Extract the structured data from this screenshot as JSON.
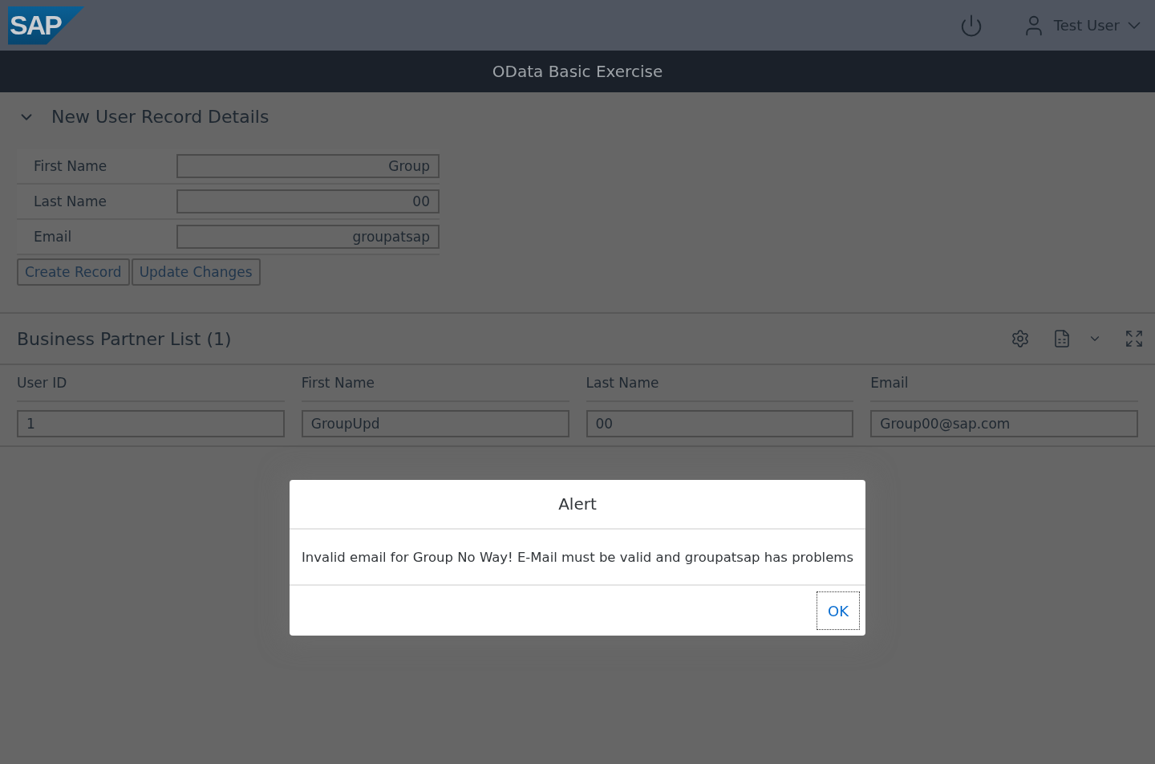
{
  "shell": {
    "logo": "SAP",
    "user": "Test User"
  },
  "app_title": "OData Basic Exercise",
  "form": {
    "title": "New User Record Details",
    "expanded": true,
    "fields": [
      {
        "label": "First Name",
        "value": "Group"
      },
      {
        "label": "Last Name",
        "value": "00"
      },
      {
        "label": "Email",
        "value": "groupatsap"
      }
    ],
    "buttons": [
      "Create Record",
      "Update Changes"
    ]
  },
  "table": {
    "title": "Business Partner List (1)",
    "columns": [
      "User ID",
      "First Name",
      "Last Name",
      "Email"
    ],
    "rows": [
      [
        "1",
        "GroupUpd",
        "00",
        "Group00@sap.com"
      ]
    ]
  },
  "dialog": {
    "title": "Alert",
    "message": "Invalid email for Group No Way! E-Mail must be valid and groupatsap has problems",
    "buttons": [
      "OK"
    ]
  }
}
